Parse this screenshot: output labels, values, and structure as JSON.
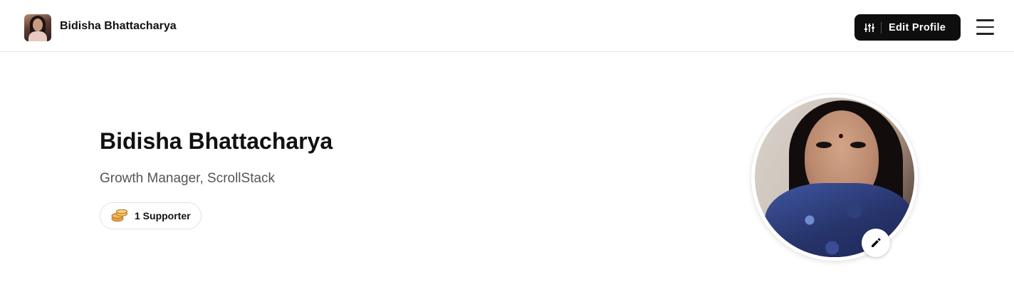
{
  "header": {
    "name": "Bidisha Bhattacharya",
    "edit_profile_label": "Edit Profile",
    "edit_profile_icon": "sliders-icon",
    "menu_icon": "hamburger-menu-icon"
  },
  "profile": {
    "name": "Bidisha Bhattacharya",
    "role": "Growth Manager, ScrollStack",
    "supporters_label": "1 Supporter",
    "supporters_icon": "coins-icon",
    "edit_photo_icon": "pencil-icon"
  },
  "colors": {
    "primary_button": "#0e0e0e",
    "background": "#ffffff",
    "muted_text": "#555555",
    "coin": "#e0a04a"
  }
}
